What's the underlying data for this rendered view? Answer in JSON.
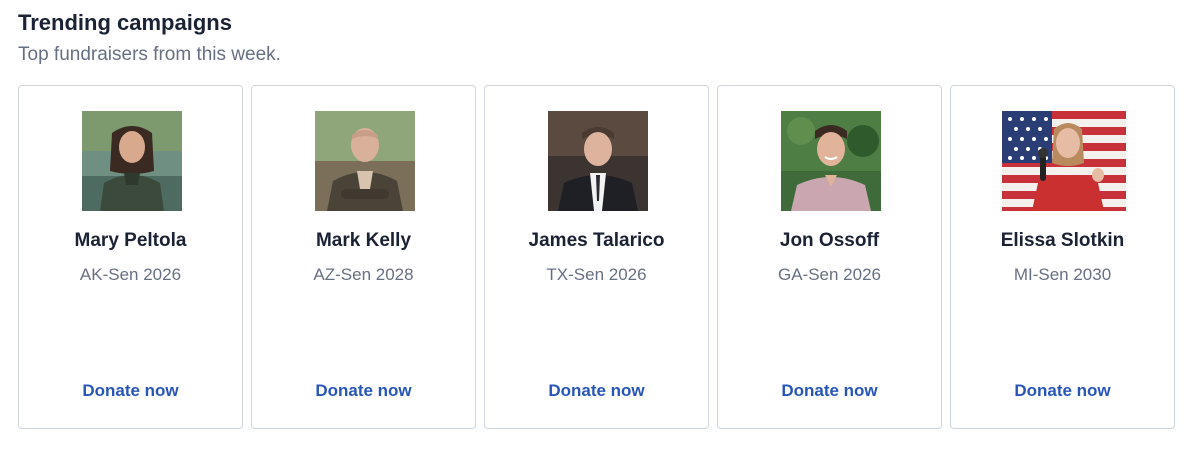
{
  "header": {
    "title": "Trending campaigns",
    "subtitle": "Top fundraisers from this week."
  },
  "campaigns": [
    {
      "name": "Mary Peltola",
      "race": "AK-Sen 2026",
      "action": "Donate now"
    },
    {
      "name": "Mark Kelly",
      "race": "AZ-Sen 2028",
      "action": "Donate now"
    },
    {
      "name": "James Talarico",
      "race": "TX-Sen 2026",
      "action": "Donate now"
    },
    {
      "name": "Jon Ossoff",
      "race": "GA-Sen 2026",
      "action": "Donate now"
    },
    {
      "name": "Elissa Slotkin",
      "race": "MI-Sen 2030",
      "action": "Donate now"
    }
  ],
  "colors": {
    "link": "#2856b8",
    "title": "#1b2233",
    "muted": "#677082",
    "border": "#cfd5dd"
  }
}
